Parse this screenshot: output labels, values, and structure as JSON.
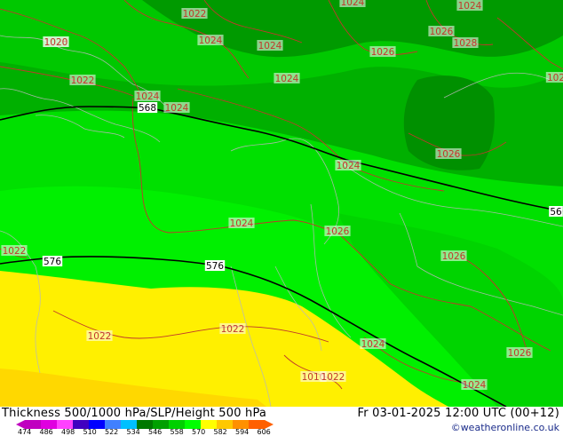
{
  "map": {
    "pressure_labels": [
      "1022",
      "1024",
      "1024",
      "1024",
      "1028",
      "1026",
      "1028",
      "1024",
      "1026",
      "1020",
      "1022",
      "1024",
      "1024",
      "1024",
      "1026",
      "1024",
      "1024",
      "1026",
      "1022",
      "1022",
      "1022",
      "1024",
      "1026",
      "1024",
      "1010",
      "1022",
      "1026",
      "102"
    ],
    "height_contours": [
      "568",
      "56",
      "576",
      "576"
    ],
    "colors": {
      "thickness_556": "#00b000",
      "thickness_558": "#00c800",
      "thickness_562": "#00e000",
      "thickness_566": "#00f000",
      "thickness_570": "#fff000",
      "thickness_574": "#ffd800",
      "pressure_contour": "#c0392b",
      "height_contour": "#000000",
      "coastline": "#b0b0b0"
    }
  },
  "footer": {
    "title": "Thickness 500/1000 hPa/SLP/Height 500 hPa",
    "datetime": "Fr 03-01-2025 12:00 UTC (00+12)",
    "copyright": "©weatheronline.co.uk",
    "legend_values": [
      "474",
      "486",
      "498",
      "510",
      "522",
      "534",
      "546",
      "558",
      "570",
      "582",
      "594",
      "606"
    ],
    "legend_colors": [
      "#c000c0",
      "#e000e0",
      "#ff40ff",
      "#4000c0",
      "#0000ff",
      "#4080ff",
      "#00c0ff",
      "#007800",
      "#00a000",
      "#00d000",
      "#00ff00",
      "#ffff00",
      "#ffc800",
      "#ff9000",
      "#ff6000"
    ]
  }
}
